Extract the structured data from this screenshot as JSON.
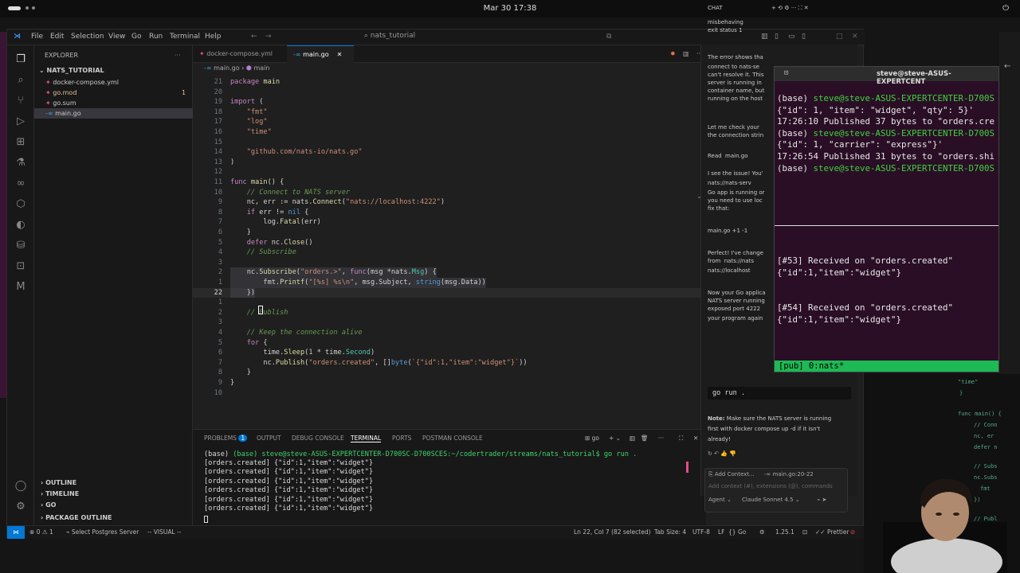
{
  "topbar": {
    "datetime": "Mar 30  17:38"
  },
  "vscode": {
    "menu": [
      "File",
      "Edit",
      "Selection",
      "View",
      "Go",
      "Run",
      "Terminal",
      "Help"
    ],
    "search": "nats_tutorial",
    "explorer_title": "EXPLORER",
    "project": "NATS_TUTORIAL",
    "files": [
      {
        "name": "docker-compose.yml",
        "badge": ""
      },
      {
        "name": "go.mod",
        "badge": "1"
      },
      {
        "name": "go.sum",
        "badge": ""
      },
      {
        "name": "main.go",
        "badge": ""
      }
    ],
    "outline_sections": [
      "OUTLINE",
      "TIMELINE",
      "GO",
      "PACKAGE OUTLINE"
    ],
    "tabs": [
      "docker-compose.yml",
      "main.go"
    ],
    "breadcrumb": {
      "file": "main.go",
      "symbol": "main"
    },
    "code_lines": [
      {
        "n": "21",
        "t": "package main"
      },
      {
        "n": "20",
        "t": ""
      },
      {
        "n": "19",
        "t": "import ("
      },
      {
        "n": "18",
        "t": "    \"fmt\""
      },
      {
        "n": "17",
        "t": "    \"log\""
      },
      {
        "n": "16",
        "t": "    \"time\""
      },
      {
        "n": "15",
        "t": ""
      },
      {
        "n": "14",
        "t": "    \"github.com/nats-io/nats.go\""
      },
      {
        "n": "13",
        "t": ")"
      },
      {
        "n": "12",
        "t": ""
      },
      {
        "n": "11",
        "t": "func main() {"
      },
      {
        "n": "10",
        "t": "    // Connect to NATS server"
      },
      {
        "n": "9",
        "t": "    nc, err := nats.Connect(\"nats://localhost:4222\")"
      },
      {
        "n": "8",
        "t": "    if err != nil {"
      },
      {
        "n": "7",
        "t": "        log.Fatal(err)"
      },
      {
        "n": "6",
        "t": "    }"
      },
      {
        "n": "5",
        "t": "    defer nc.Close()"
      },
      {
        "n": "4",
        "t": "    // Subscribe"
      },
      {
        "n": "3",
        "t": ""
      },
      {
        "n": "2",
        "t": "    nc.Subscribe(\"orders.>\", func(msg *nats.Msg) {"
      },
      {
        "n": "1",
        "t": "        fmt.Printf(\"[%s] %s\\n\", msg.Subject, string(msg.Data))"
      },
      {
        "n": "22",
        "t": "    })"
      },
      {
        "n": "1",
        "t": ""
      },
      {
        "n": "2",
        "t": "    // Publish"
      },
      {
        "n": "3",
        "t": ""
      },
      {
        "n": "4",
        "t": "    // Keep the connection alive"
      },
      {
        "n": "5",
        "t": "    for {"
      },
      {
        "n": "6",
        "t": "        time.Sleep(1 * time.Second)"
      },
      {
        "n": "7",
        "t": "        nc.Publish(\"orders.created\", []byte(`{\"id\":1,\"item\":\"widget\"}`))"
      },
      {
        "n": "8",
        "t": "    }"
      },
      {
        "n": "9",
        "t": "}"
      },
      {
        "n": "10",
        "t": ""
      }
    ],
    "panel_tabs": [
      "PROBLEMS",
      "OUTPUT",
      "DEBUG CONSOLE",
      "TERMINAL",
      "PORTS",
      "POSTMAN CONSOLE"
    ],
    "problems_count": "1",
    "terminal_prompt": "(base) steve@steve-ASUS-EXPERTCENTER-D700SC-D700SCES:~/codertrader/streams/nats_tutorial$ go run .",
    "terminal_output": [
      "[orders.created] {\"id\":1,\"item\":\"widget\"}",
      "[orders.created] {\"id\":1,\"item\":\"widget\"}",
      "[orders.created] {\"id\":1,\"item\":\"widget\"}",
      "[orders.created] {\"id\":1,\"item\":\"widget\"}",
      "[orders.created] {\"id\":1,\"item\":\"widget\"}",
      "[orders.created] {\"id\":1,\"item\":\"widget\"}"
    ],
    "status": {
      "errors": "0",
      "warnings": "1",
      "postgres": "Select Postgres Server",
      "visual": "-- VISUAL --",
      "position": "Ln 22, Col 7 (82 selected)",
      "tab_size": "Tab Size: 4",
      "encoding": "UTF-8",
      "eol": "LF",
      "lang": "Go",
      "go_version": "1.25.1",
      "prettier": "Prettier"
    }
  },
  "chat": {
    "title": "CHAT",
    "snippets": [
      "misbehaving",
      "exit status 1",
      "The error shows tha",
      "connect to nats-se",
      "can't resolve it. This",
      "server is running in",
      "container name, but",
      "running on the host",
      "Let me check your",
      "the connection strin",
      "Read  main.go",
      "I see the issue! You'",
      "nats://nats-serv",
      "Go app is running or",
      "you need to use loc",
      "fix that:",
      "main.go +1 -1",
      "Perfect! I've change",
      "from  nats://nats",
      "nats://localhost",
      "Now your Go applica",
      "NATS server running",
      "exposed port 4222",
      "your program again"
    ],
    "command": "go run .",
    "note_label": "Note:",
    "note_lines": [
      " Make sure the NATS server is running",
      "first with docker compose up -d if it isn't",
      "already!"
    ],
    "add_context": "Add Context...",
    "context_file": "main.go:20-22",
    "input_placeholder": "Add context (#), extensions (@), commands",
    "mode": "Agent",
    "model": "Claude Sonnet 4.5"
  },
  "terminal": {
    "title": "steve@steve-ASUS-EXPERTCENT",
    "lines": [
      {
        "pre": "(base) ",
        "user": "steve@steve-ASUS-EXPERTCENTER-D700S"
      },
      {
        "text": "{\"id\": 1, \"item\": \"widget\", \"qty\": 5}'"
      },
      {
        "text": "17:26:10 Published 37 bytes to \"orders.cre"
      },
      {
        "pre": "(base) ",
        "user": "steve@steve-ASUS-EXPERTCENTER-D700S"
      },
      {
        "text": "{\"id\": 1, \"carrier\": \"express\"}'"
      },
      {
        "text": "17:26:54 Published 31 bytes to \"orders.shi"
      },
      {
        "pre": "(base) ",
        "user": "steve@steve-ASUS-EXPERTCENTER-D700S"
      }
    ],
    "received": [
      {
        "head": "[#53] Received on \"orders.created\"",
        "body": "{\"id\":1,\"item\":\"widget\"}"
      },
      {
        "head": "[#54] Received on \"orders.created\"",
        "body": "{\"id\":1,\"item\":\"widget\"}"
      }
    ],
    "tmux_status": "[pub] 0:nats*"
  },
  "background_code": [
    "\"time\"",
    "}",
    "func main() {",
    "// Conn",
    "nc, er",
    "defer n",
    "// Subs",
    "nc.Subs",
    "fmt",
    "})",
    "// Publ"
  ]
}
